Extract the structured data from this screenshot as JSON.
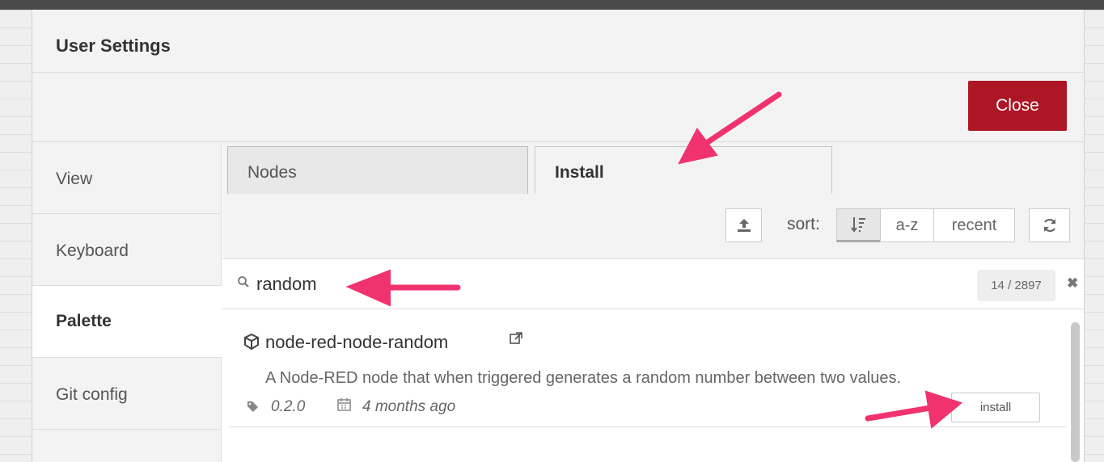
{
  "dialog": {
    "title": "User Settings",
    "close_label": "Close"
  },
  "sidebar": {
    "items": [
      {
        "label": "View"
      },
      {
        "label": "Keyboard"
      },
      {
        "label": "Palette"
      },
      {
        "label": "Git config"
      }
    ],
    "active": "Palette"
  },
  "tabs": [
    {
      "label": "Nodes"
    },
    {
      "label": "Install"
    }
  ],
  "toolbar": {
    "upload_icon": "upload-icon",
    "sort_label": "sort:",
    "sort_relevance_icon": "sort-relevance-icon",
    "sort_az_label": "a-z",
    "sort_recent_label": "recent",
    "refresh_icon": "refresh-icon"
  },
  "search": {
    "value": "random",
    "count": "14 / 2897"
  },
  "results": [
    {
      "name": "node-red-node-random",
      "description": "A Node-RED node that when triggered generates a random number between two values.",
      "version": "0.2.0",
      "updated": "4 months ago",
      "install_label": "install"
    }
  ],
  "colors": {
    "close_button": "#ad1625",
    "annotation_arrow": "#f0326e"
  }
}
